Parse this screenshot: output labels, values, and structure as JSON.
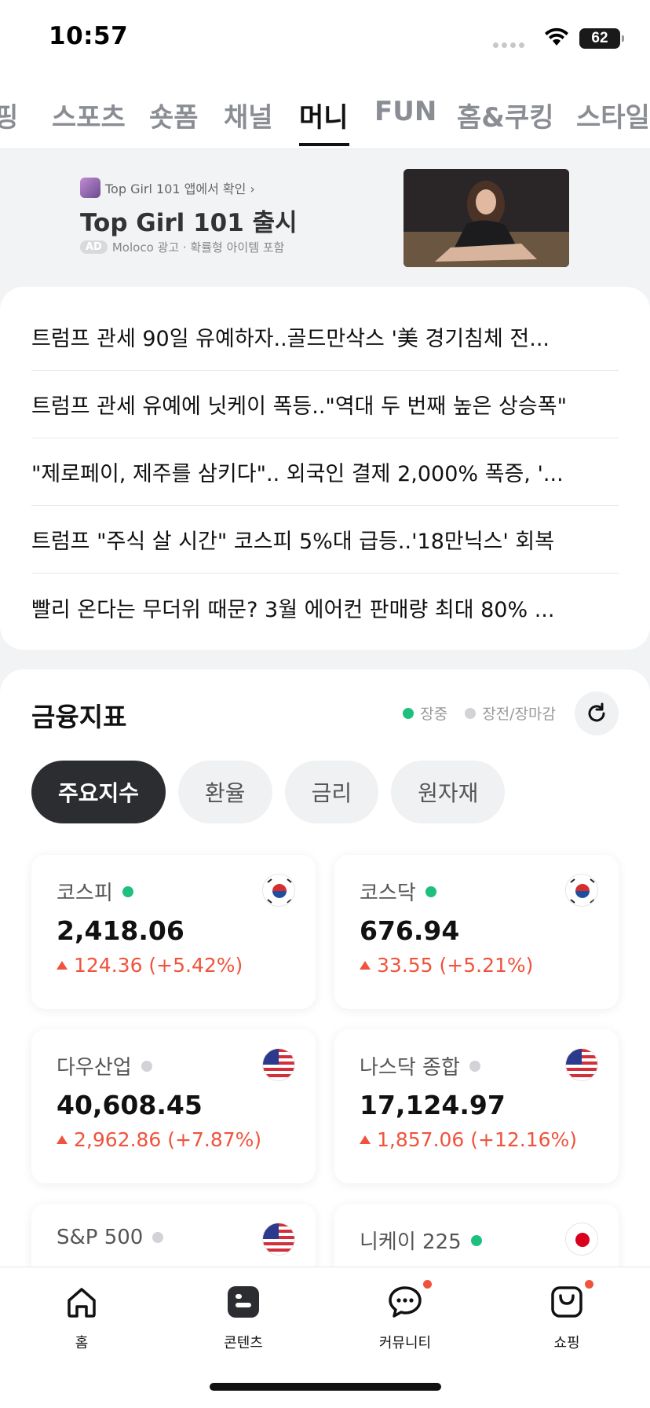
{
  "status_bar": {
    "time": "10:57",
    "battery": "62"
  },
  "category_tabs": [
    {
      "label": "핑"
    },
    {
      "label": "스포츠"
    },
    {
      "label": "숏폼"
    },
    {
      "label": "채널"
    },
    {
      "label": "머니",
      "active": true
    },
    {
      "label": "FUN"
    },
    {
      "label": "홈&쿠킹"
    },
    {
      "label": "스타일"
    }
  ],
  "ad": {
    "source": "Top Girl 101 앱에서 확인 ›",
    "title": "Top Girl 101 출시",
    "badge": "AD",
    "meta": "Moloco 광고 · 확률형 아이템 포함"
  },
  "news": [
    "트럼프 관세 90일 유예하자..골드만삭스 '美 경기침체 전...",
    "트럼프 관세 유예에 닛케이 폭등..\"역대 두 번째 높은 상승폭\"",
    "\"제로페이, 제주를 삼키다\".. 외국인 결제 2,000% 폭증, '...",
    "트럼프 \"주식 살 시간\" 코스피 5%대 급등..'18만닉스' 회복",
    "빨리 온다는 무더위 때문? 3월 에어컨 판매량 최대 80% ..."
  ],
  "finance": {
    "title": "금융지표",
    "legend_open": "장중",
    "legend_closed": "장전/장마감",
    "chips": [
      "주요지수",
      "환율",
      "금리",
      "원자재"
    ],
    "indices": [
      {
        "name": "코스피",
        "status": "open",
        "value": "2,418.06",
        "change": "124.36 (+5.42%)",
        "flag": "kr"
      },
      {
        "name": "코스닥",
        "status": "open",
        "value": "676.94",
        "change": "33.55 (+5.21%)",
        "flag": "kr"
      },
      {
        "name": "다우산업",
        "status": "closed",
        "value": "40,608.45",
        "change": "2,962.86 (+7.87%)",
        "flag": "us"
      },
      {
        "name": "나스닥 종합",
        "status": "closed",
        "value": "17,124.97",
        "change": "1,857.06 (+12.16%)",
        "flag": "us"
      },
      {
        "name": "S&P 500",
        "status": "closed",
        "value": "",
        "change": "",
        "flag": "us"
      },
      {
        "name": "니케이 225",
        "status": "open",
        "value": "",
        "change": "",
        "flag": "jp"
      }
    ],
    "colors": {
      "up": "#f0533d",
      "open": "#1fc07e",
      "closed": "#d2d3d6"
    }
  },
  "bottom_nav": [
    {
      "label": "홈",
      "icon": "home-icon"
    },
    {
      "label": "콘텐츠",
      "icon": "contents-icon"
    },
    {
      "label": "커뮤니티",
      "icon": "chat-icon",
      "badge": true
    },
    {
      "label": "쇼핑",
      "icon": "shopping-bag-icon",
      "badge": true
    }
  ]
}
